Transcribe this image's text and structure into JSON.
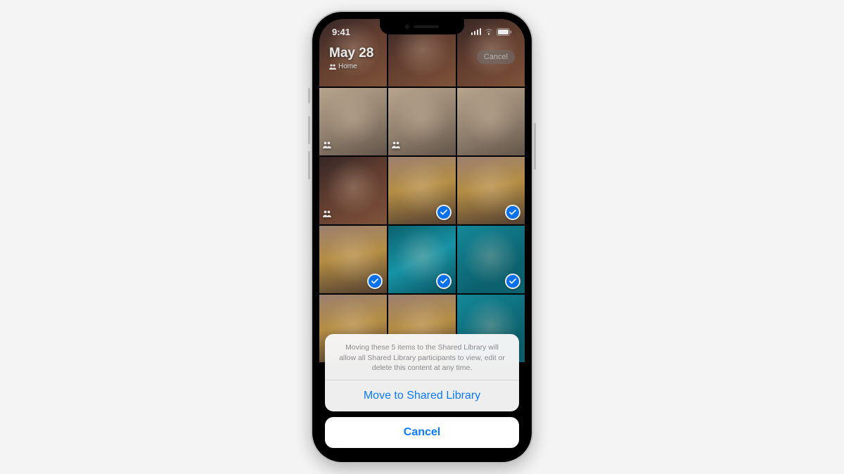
{
  "status": {
    "time": "9:41"
  },
  "header": {
    "date": "May 28",
    "location_label": "Home",
    "top_right_button": "Cancel"
  },
  "grid": {
    "tiles": [
      {
        "style": "warm",
        "shared": false,
        "selected": false
      },
      {
        "style": "warm",
        "shared": false,
        "selected": false
      },
      {
        "style": "warm",
        "shared": false,
        "selected": false
      },
      {
        "style": "beige",
        "shared": true,
        "selected": false
      },
      {
        "style": "beige",
        "shared": true,
        "selected": false
      },
      {
        "style": "beige",
        "shared": false,
        "selected": false
      },
      {
        "style": "warm",
        "shared": true,
        "selected": false
      },
      {
        "style": "dusk",
        "shared": false,
        "selected": true
      },
      {
        "style": "dusk",
        "shared": false,
        "selected": true
      },
      {
        "style": "dusk",
        "shared": false,
        "selected": true
      },
      {
        "style": "teal",
        "shared": false,
        "selected": true
      },
      {
        "style": "tealp",
        "shared": false,
        "selected": true
      },
      {
        "style": "dusk",
        "shared": false,
        "selected": false
      },
      {
        "style": "dusk",
        "shared": false,
        "selected": false
      },
      {
        "style": "tealp",
        "shared": false,
        "selected": false
      }
    ]
  },
  "sheet": {
    "message": "Moving these 5 items to the Shared Library will allow all Shared Library participants to view, edit or delete this content at any time.",
    "action_label": "Move to Shared Library",
    "cancel_label": "Cancel"
  }
}
